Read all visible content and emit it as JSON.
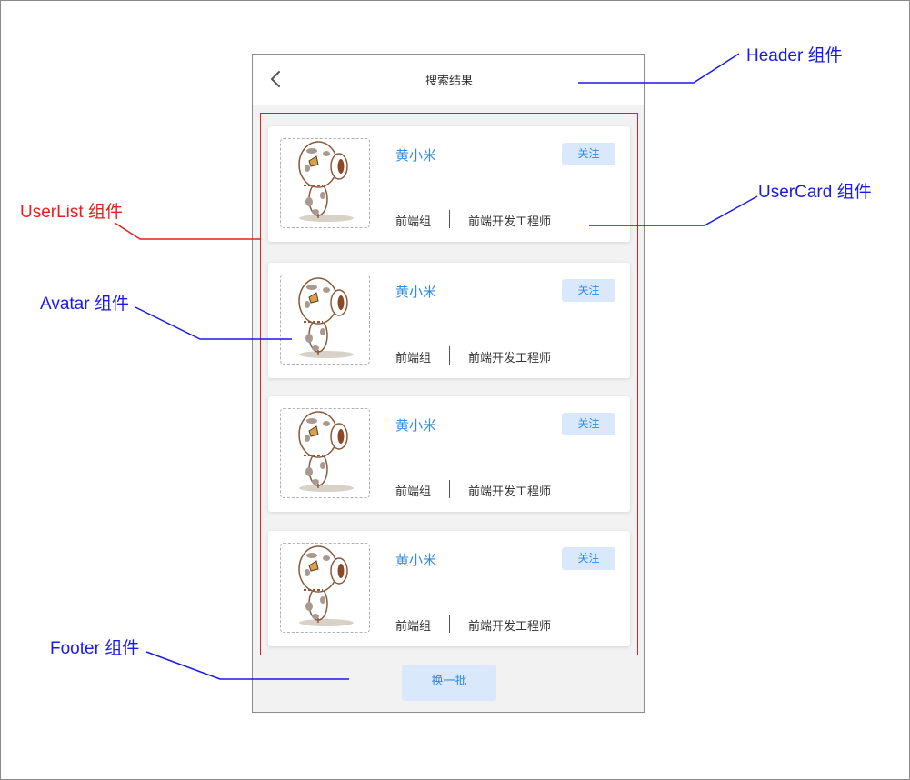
{
  "header": {
    "title": "搜索结果"
  },
  "user_cards": [
    {
      "name": "黄小米",
      "follow_label": "关注",
      "group": "前端组",
      "job_title": "前端开发工程师"
    },
    {
      "name": "黄小米",
      "follow_label": "关注",
      "group": "前端组",
      "job_title": "前端开发工程师"
    },
    {
      "name": "黄小米",
      "follow_label": "关注",
      "group": "前端组",
      "job_title": "前端开发工程师"
    },
    {
      "name": "黄小米",
      "follow_label": "关注",
      "group": "前端组",
      "job_title": "前端开发工程师"
    }
  ],
  "footer": {
    "button_label": "换一批"
  },
  "annotations": {
    "header": "Header 组件",
    "user_card": "UserCard 组件",
    "user_list": "UserList 组件",
    "avatar": "Avatar 组件",
    "footer": "Footer 组件"
  },
  "icons": {
    "back": "chevron-left-icon",
    "avatar": "cartoon-cow-avatar"
  },
  "colors": {
    "annotation_blue": "#1a1ae6",
    "annotation_red": "#e81e1e",
    "link_blue": "#2f8ae5",
    "button_bg": "#d9e8fb"
  }
}
